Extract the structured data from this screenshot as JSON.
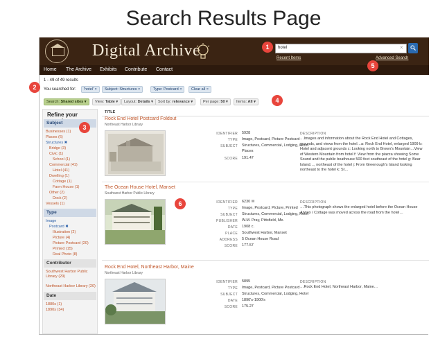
{
  "slide_title": "Search Results Page",
  "header": {
    "brand": "Digital Archive",
    "search_value": "hotel",
    "recent_label": "Recent Items",
    "advanced_label": "Advanced Search"
  },
  "nav": [
    "Home",
    "The Archive",
    "Exhibits",
    "Contribute",
    "Contact"
  ],
  "results_count": "1 - 49 of 49 results",
  "searched_for_label": "You searched for:",
  "filter_chips": [
    "'hotel' ×",
    "Subject: Structures ×",
    "Type: Postcard ×",
    "Clear all ×"
  ],
  "controls": [
    {
      "label": "Search:",
      "value": "Shared sites ▾"
    },
    {
      "label": "View:",
      "value": "Table ▾"
    },
    {
      "label": "Layout:",
      "value": "Details ▾"
    },
    {
      "label": "Sort by:",
      "value": "relevance ▾"
    },
    {
      "label": "Per page:",
      "value": "50 ▾"
    },
    {
      "label": "Items:",
      "value": "All ▾"
    }
  ],
  "sidebar": {
    "title": "Refine your search",
    "subject_header": "Subject",
    "subject_items": [
      "Businesses (1)",
      "Places (6)",
      "Structures ✖",
      "Bridge (3)",
      "Civic (1)",
      "School (1)",
      "Commercial (41)",
      "Hotel (41)",
      "Dwelling (1)",
      "Cottage (1)",
      "Farm House (1)",
      "Other (2)",
      "Dock (2)",
      "Vessels (1)"
    ],
    "type_header": "Type",
    "type_items": [
      "Image",
      "Postcard ✖",
      "Illustration (2)",
      "Picture (4)",
      "Picture Postcard (20)",
      "Printed (15)",
      "Real Photo (8)"
    ],
    "contributor_header": "Contributor",
    "contributor_items": [
      "Southwest Harbor Public Library (29)",
      "Northeast Harbor Library (20)"
    ],
    "date_header": "Date",
    "date_items": [
      "1880s (1)",
      "1890s (34)"
    ]
  },
  "column_title": "Title",
  "results": [
    {
      "title": "Rock End Hotel Postcard Foldout",
      "source": "Northeast Harbor Library",
      "fields": [
        {
          "k": "Identifier",
          "v": "5928"
        },
        {
          "k": "Type",
          "v": "Image, Postcard, Picture Postcard"
        },
        {
          "k": "Subject",
          "v": "Structures, Commercial, Lodging, Hotel Places"
        },
        {
          "k": "Score",
          "v": "191.47"
        }
      ],
      "desc_label": "Description",
      "desc": "…Images and information about the Rock End Hotel and Cottages, grounds, and views from the hotel…a: Rock End Hotel, enlarged 1909 b: Hotel and adjacent grounds c: Looking north to Brown's Mountain…View of Western Mountain from hotel f: View from the piazza showing Some Sound and the public boathouse 500 feet southeast of the hotel g: Bear Island…, northeast of the hotel j: From Greenough's Island looking northeast to the hotel k: St…"
    },
    {
      "title": "The Ocean House Hotel, Manset",
      "source": "Southwest Harbor Public Library",
      "fields": [
        {
          "k": "Identifier",
          "v": "6230 ✉"
        },
        {
          "k": "Type",
          "v": "Image, Postcard, Picture, Printed"
        },
        {
          "k": "Subject",
          "v": "Structures, Commercial, Lodging, Hotel"
        },
        {
          "k": "Publisher",
          "v": "W.M. Pray, Pittsfield, Me."
        },
        {
          "k": "Date",
          "v": "1908 c."
        },
        {
          "k": "Place",
          "v": "Southwest Harbor, Manset"
        },
        {
          "k": "Address",
          "v": "5 Ocean House Road"
        },
        {
          "k": "Score",
          "v": "177.57"
        }
      ],
      "desc_label": "Description",
      "desc": "…This photograph shows the enlarged hotel before the Ocean House Annex / Cottage was moved across the road from the hotel…"
    },
    {
      "title": "Rock End Hotel, Northeast Harbor, Maine",
      "source": "Northeast Harbor Library",
      "fields": [
        {
          "k": "Identifier",
          "v": "5895"
        },
        {
          "k": "Type",
          "v": "Image, Postcard, Picture Postcard"
        },
        {
          "k": "Subject",
          "v": "Structures, Commercial, Lodging, Hotel"
        },
        {
          "k": "Date",
          "v": "1890's-1900's"
        },
        {
          "k": "Score",
          "v": "175.27"
        }
      ],
      "desc_label": "Description",
      "desc": "…Rock End Hotel, Northeast Harbor, Maine…"
    }
  ],
  "badges": [
    "1",
    "2",
    "3",
    "4",
    "5",
    "6"
  ]
}
